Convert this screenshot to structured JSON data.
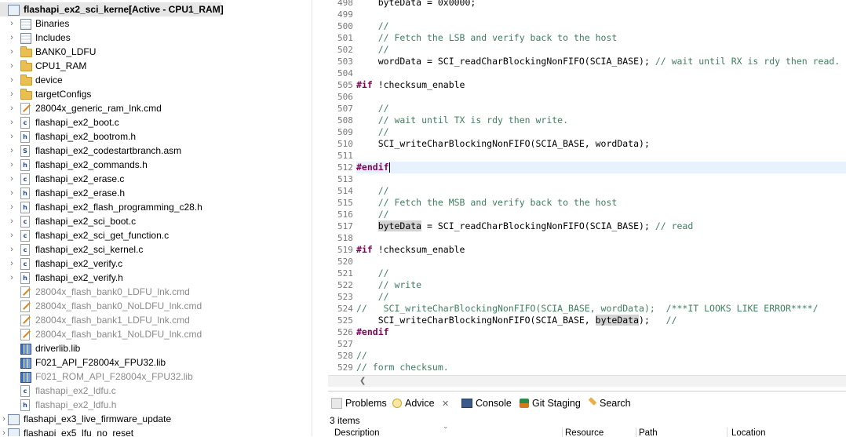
{
  "project": {
    "name": "flashapi_ex2_sci_kernel",
    "status": "[Active - CPU1_RAM]",
    "items": [
      {
        "label": "Binaries",
        "kind": "bins",
        "twisty": "›",
        "dim": false
      },
      {
        "label": "Includes",
        "kind": "bins",
        "twisty": "›",
        "dim": false
      },
      {
        "label": "BANK0_LDFU",
        "kind": "folder",
        "twisty": "›",
        "dim": false
      },
      {
        "label": "CPU1_RAM",
        "kind": "folder",
        "twisty": "›",
        "dim": false
      },
      {
        "label": "device",
        "kind": "folder",
        "twisty": "›",
        "dim": false
      },
      {
        "label": "targetConfigs",
        "kind": "folder",
        "twisty": "›",
        "dim": false
      },
      {
        "label": "28004x_generic_ram_lnk.cmd",
        "kind": "lnk",
        "twisty": "›",
        "dim": false
      },
      {
        "label": "flashapi_ex2_boot.c",
        "kind": "c",
        "twisty": "›",
        "dim": false
      },
      {
        "label": "flashapi_ex2_bootrom.h",
        "kind": "h",
        "twisty": "›",
        "dim": false
      },
      {
        "label": "flashapi_ex2_codestartbranch.asm",
        "kind": "s",
        "twisty": "›",
        "dim": false
      },
      {
        "label": "flashapi_ex2_commands.h",
        "kind": "h",
        "twisty": "›",
        "dim": false
      },
      {
        "label": "flashapi_ex2_erase.c",
        "kind": "c",
        "twisty": "›",
        "dim": false
      },
      {
        "label": "flashapi_ex2_erase.h",
        "kind": "h",
        "twisty": "›",
        "dim": false
      },
      {
        "label": "flashapi_ex2_flash_programming_c28.h",
        "kind": "h",
        "twisty": "›",
        "dim": false
      },
      {
        "label": "flashapi_ex2_sci_boot.c",
        "kind": "c",
        "twisty": "›",
        "dim": false
      },
      {
        "label": "flashapi_ex2_sci_get_function.c",
        "kind": "c",
        "twisty": "›",
        "dim": false
      },
      {
        "label": "flashapi_ex2_sci_kernel.c",
        "kind": "c",
        "twisty": "›",
        "dim": false
      },
      {
        "label": "flashapi_ex2_verify.c",
        "kind": "c",
        "twisty": "›",
        "dim": false
      },
      {
        "label": "flashapi_ex2_verify.h",
        "kind": "h",
        "twisty": "›",
        "dim": false
      },
      {
        "label": "28004x_flash_bank0_LDFU_lnk.cmd",
        "kind": "lnk",
        "twisty": "",
        "dim": true
      },
      {
        "label": "28004x_flash_bank0_NoLDFU_lnk.cmd",
        "kind": "lnk",
        "twisty": "",
        "dim": true
      },
      {
        "label": "28004x_flash_bank1_LDFU_lnk.cmd",
        "kind": "lnk",
        "twisty": "",
        "dim": true
      },
      {
        "label": "28004x_flash_bank1_NoLDFU_lnk.cmd",
        "kind": "lnk",
        "twisty": "",
        "dim": true
      },
      {
        "label": "driverlib.lib",
        "kind": "lib",
        "twisty": "",
        "dim": false
      },
      {
        "label": "F021_API_F28004x_FPU32.lib",
        "kind": "lib",
        "twisty": "",
        "dim": false
      },
      {
        "label": "F021_ROM_API_F28004x_FPU32.lib",
        "kind": "lib",
        "twisty": "",
        "dim": true
      },
      {
        "label": "flashapi_ex2_ldfu.c",
        "kind": "c",
        "twisty": "",
        "dim": true
      },
      {
        "label": "flashapi_ex2_ldfu.h",
        "kind": "h",
        "twisty": "",
        "dim": true
      }
    ],
    "siblings": [
      {
        "label": "flashapi_ex3_live_firmware_update"
      },
      {
        "label": "flashapi_ex5_lfu_no_reset"
      }
    ]
  },
  "editor": {
    "lines": [
      {
        "n": "498",
        "t": "    byteData = 0x0000;",
        "cls": ""
      },
      {
        "n": "499",
        "t": "",
        "cls": ""
      },
      {
        "n": "500",
        "t": "    //",
        "cls": "c"
      },
      {
        "n": "501",
        "t": "    // Fetch the LSB and verify back to the host",
        "cls": "c"
      },
      {
        "n": "502",
        "t": "    //",
        "cls": "c"
      },
      {
        "n": "503",
        "t": "    wordData = SCI_readCharBlockingNonFIFO(SCIA_BASE); // wait until RX is rdy then read.",
        "cls": "mix503"
      },
      {
        "n": "504",
        "t": "",
        "cls": ""
      },
      {
        "n": "505",
        "t": "#if !checksum_enable",
        "cls": "pp"
      },
      {
        "n": "506",
        "t": "",
        "cls": ""
      },
      {
        "n": "507",
        "t": "    //",
        "cls": "c"
      },
      {
        "n": "508",
        "t": "    // wait until TX is rdy then write.",
        "cls": "c"
      },
      {
        "n": "509",
        "t": "    //",
        "cls": "c"
      },
      {
        "n": "510",
        "t": "    SCI_writeCharBlockingNonFIFO(SCIA_BASE, wordData);",
        "cls": ""
      },
      {
        "n": "511",
        "t": "",
        "cls": ""
      },
      {
        "n": "512",
        "t": "#endif",
        "cls": "cur"
      },
      {
        "n": "513",
        "t": "",
        "cls": ""
      },
      {
        "n": "514",
        "t": "    //",
        "cls": "c"
      },
      {
        "n": "515",
        "t": "    // Fetch the MSB and verify back to the host",
        "cls": "c"
      },
      {
        "n": "516",
        "t": "    //",
        "cls": "c"
      },
      {
        "n": "517",
        "t": "    byteData = SCI_readCharBlockingNonFIFO(SCIA_BASE); // read",
        "cls": "mix517"
      },
      {
        "n": "518",
        "t": "",
        "cls": ""
      },
      {
        "n": "519",
        "t": "#if !checksum_enable",
        "cls": "pp"
      },
      {
        "n": "520",
        "t": "",
        "cls": ""
      },
      {
        "n": "521",
        "t": "    //",
        "cls": "c"
      },
      {
        "n": "522",
        "t": "    // write",
        "cls": "c"
      },
      {
        "n": "523",
        "t": "    //",
        "cls": "c"
      },
      {
        "n": "524",
        "t": "//   SCI_writeCharBlockingNonFIFO(SCIA_BASE, wordData);  /***IT LOOKS LIKE ERROR****/",
        "cls": "c"
      },
      {
        "n": "525",
        "t": "    SCI_writeCharBlockingNonFIFO(SCIA_BASE, byteData);   //",
        "cls": "mix525"
      },
      {
        "n": "526",
        "t": "#endif",
        "cls": "pp"
      },
      {
        "n": "527",
        "t": "",
        "cls": ""
      },
      {
        "n": "528",
        "t": "//",
        "cls": "c"
      },
      {
        "n": "529",
        "t": "// form checksum.",
        "cls": "c"
      }
    ]
  },
  "panel": {
    "tabs": [
      {
        "label": "Problems",
        "icon": "problems-icon"
      },
      {
        "label": "Advice",
        "icon": "advice-icon"
      },
      {
        "label": "Console",
        "icon": "console-icon"
      },
      {
        "label": "Git Staging",
        "icon": "git-staging-icon"
      },
      {
        "label": "Search",
        "icon": "search-icon"
      }
    ],
    "close_glyph": "✕",
    "items_count": "3 items",
    "columns": [
      "Description",
      "Resource",
      "Path",
      "Location"
    ]
  }
}
